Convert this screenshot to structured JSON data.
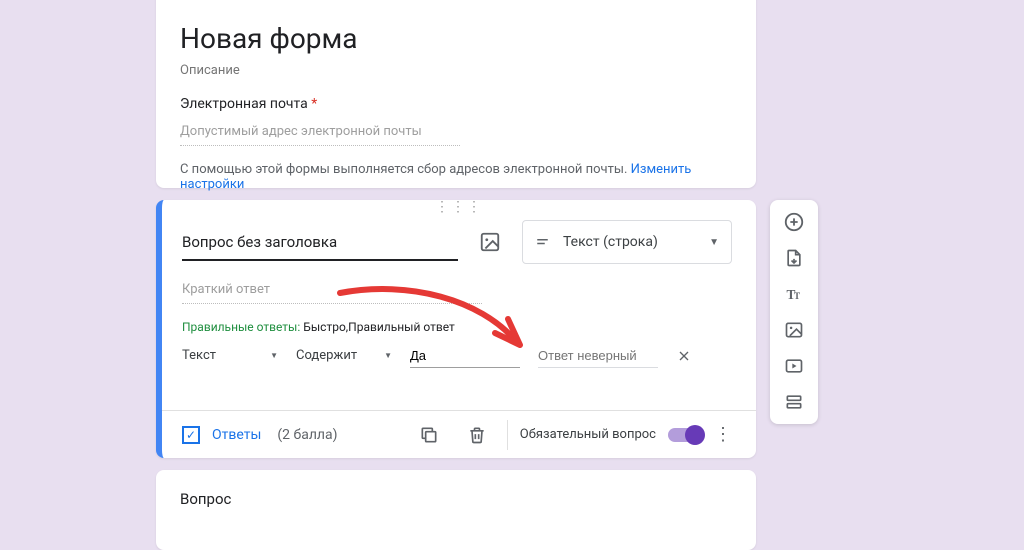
{
  "header": {
    "title": "Новая форма",
    "description": "Описание",
    "email_label": "Электронная почта",
    "required_marker": "*",
    "email_placeholder": "Допустимый адрес электронной почты",
    "email_notice": "С помощью этой формы выполняется сбор адресов электронной почты.",
    "change_settings": "Изменить настройки"
  },
  "question": {
    "title": "Вопрос без заголовка",
    "type_label": "Текст (строка)",
    "short_answer_placeholder": "Краткий ответ",
    "correct_label": "Правильные ответы:",
    "correct_values": "Быстро,Правильный ответ",
    "validation": {
      "kind": "Текст",
      "op": "Содержит",
      "value": "Да",
      "error_placeholder": "Ответ неверный"
    }
  },
  "footer": {
    "answers_label": "Ответы",
    "points_label": "(2 балла)",
    "required_label": "Обязательный вопрос"
  },
  "next_question": {
    "title": "Вопрос"
  },
  "icons": {
    "image": "image-icon",
    "short_text": "short-text-icon",
    "copy": "copy-icon",
    "trash": "trash-icon",
    "add": "add-icon",
    "import": "import-icon",
    "title": "title-icon",
    "image2": "image-icon",
    "video": "video-icon",
    "section": "section-icon"
  }
}
